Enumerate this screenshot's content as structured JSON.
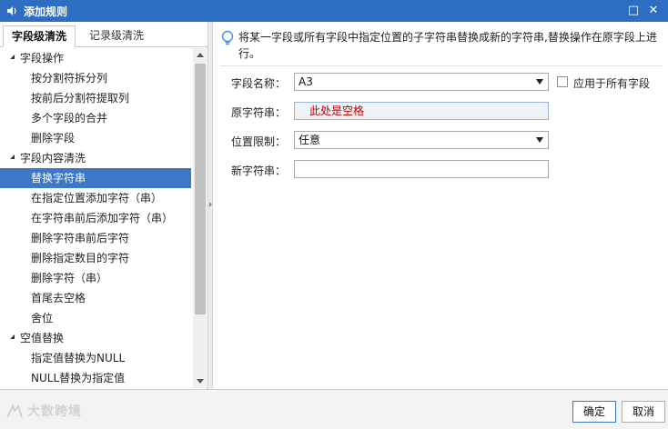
{
  "window": {
    "title": "添加规则",
    "maximize_glyph": "□",
    "close_glyph": "✕"
  },
  "left_panel": {
    "tabs": [
      {
        "label": "字段级清洗",
        "active": true
      },
      {
        "label": "记录级清洗",
        "active": false
      }
    ],
    "tree": [
      {
        "label": "字段操作",
        "type": "group"
      },
      {
        "label": "按分割符拆分列",
        "type": "child"
      },
      {
        "label": "按前后分割符提取列",
        "type": "child"
      },
      {
        "label": "多个字段的合并",
        "type": "child"
      },
      {
        "label": "删除字段",
        "type": "child"
      },
      {
        "label": "字段内容清洗",
        "type": "group"
      },
      {
        "label": "替换字符串",
        "type": "child",
        "selected": true
      },
      {
        "label": "在指定位置添加字符（串）",
        "type": "child"
      },
      {
        "label": "在字符串前后添加字符（串）",
        "type": "child"
      },
      {
        "label": "删除字符串前后字符",
        "type": "child"
      },
      {
        "label": "删除指定数目的字符",
        "type": "child"
      },
      {
        "label": "删除字符（串）",
        "type": "child"
      },
      {
        "label": "首尾去空格",
        "type": "child"
      },
      {
        "label": "舍位",
        "type": "child"
      },
      {
        "label": "空值替换",
        "type": "group"
      },
      {
        "label": "指定值替换为NULL",
        "type": "child"
      },
      {
        "label": "NULL替换为指定值",
        "type": "child"
      }
    ]
  },
  "right_panel": {
    "hint": "将某一字段或所有字段中指定位置的子字符串替换成新的字符串,替换操作在原字段上进行。",
    "form": {
      "field_name": {
        "label": "字段名称：",
        "value": "A3"
      },
      "apply_all": {
        "label": "应用于所有字段",
        "checked": false
      },
      "original": {
        "label": "原字符串：",
        "value": "此处是空格"
      },
      "position": {
        "label": "位置限制：",
        "value": "任意"
      },
      "new_string": {
        "label": "新字符串：",
        "value": ""
      }
    }
  },
  "footer": {
    "watermark": "大数跨境",
    "ok_label": "确定",
    "cancel_label": "取消"
  },
  "colors": {
    "titlebar": "#2e6ec2",
    "selection": "#3c78c6",
    "highlight_text": "#c00000"
  }
}
